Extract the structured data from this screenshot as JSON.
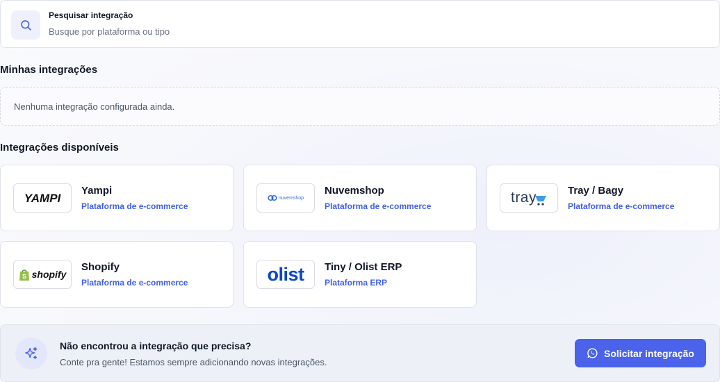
{
  "search": {
    "label": "Pesquisar integração",
    "placeholder": "Busque por plataforma ou tipo",
    "icon": "search-icon"
  },
  "my_integrations": {
    "title": "Minhas integrações",
    "empty_text": "Nenhuma integração configurada ainda."
  },
  "available": {
    "title": "Integrações disponíveis",
    "items": [
      {
        "name": "Yampi",
        "type": "Plataforma de e-commerce",
        "logo_text": "YAMPI"
      },
      {
        "name": "Nuvemshop",
        "type": "Plataforma de e-commerce",
        "logo_text": "nuvemshop"
      },
      {
        "name": "Tray / Bagy",
        "type": "Plataforma de e-commerce",
        "logo_text": "tray"
      },
      {
        "name": "Shopify",
        "type": "Plataforma de e-commerce",
        "logo_text": "shopify"
      },
      {
        "name": "Tiny / Olist ERP",
        "type": "Plataforma ERP",
        "logo_text": "olist"
      }
    ]
  },
  "banner": {
    "title": "Não encontrou a integração que precisa?",
    "subtitle": "Conte pra gente! Estamos sempre adicionando novas integrações.",
    "button_label": "Solicitar integração",
    "icon": "sparkles-icon",
    "button_icon": "whatsapp-icon"
  },
  "colors": {
    "accent": "#4a63ea",
    "link": "#4160e6",
    "nuvemshop": "#2f6bd6",
    "tray_cart": "#3d9be9",
    "shopify_green": "#95bf47",
    "olist_blue": "#0a46c7"
  }
}
